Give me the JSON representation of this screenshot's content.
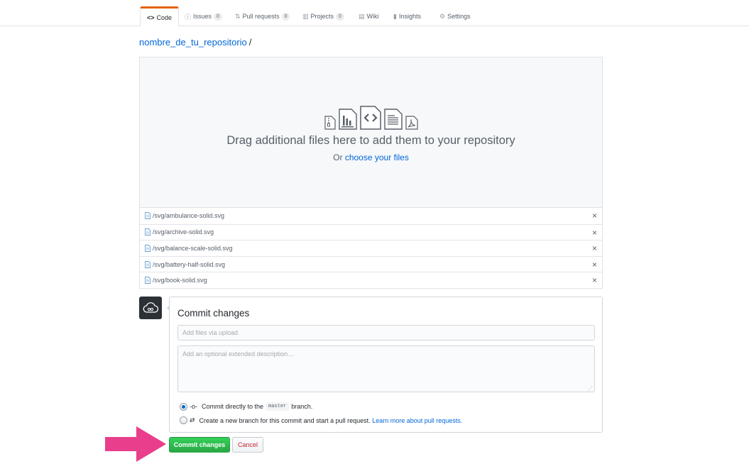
{
  "tabs": [
    {
      "icon": "code-icon",
      "glyph": "<>",
      "label": "Code",
      "selected": true
    },
    {
      "icon": "issue-icon",
      "glyph": "ⓘ",
      "label": "Issues",
      "count": "0"
    },
    {
      "icon": "pull-request-icon",
      "glyph": "⇅",
      "label": "Pull requests",
      "count": "0"
    },
    {
      "icon": "project-icon",
      "glyph": "▥",
      "label": "Projects",
      "count": "0"
    },
    {
      "icon": "wiki-icon",
      "glyph": "▤",
      "label": "Wiki"
    },
    {
      "icon": "graph-icon",
      "glyph": "▮",
      "label": "Insights"
    },
    {
      "icon": "gear-icon",
      "glyph": "⚙",
      "label": "Settings"
    }
  ],
  "breadcrumb": {
    "repo": "nombre_de_tu_repositorio",
    "separator": "/"
  },
  "dropzone": {
    "title": "Drag additional files here to add them to your repository",
    "or_text": "Or ",
    "choose_link": "choose your files"
  },
  "files": [
    {
      "path": "/svg/ambulance-solid.svg",
      "remove": "×"
    },
    {
      "path": "/svg/archive-solid.svg",
      "remove": "×"
    },
    {
      "path": "/svg/balance-scale-solid.svg",
      "remove": "×"
    },
    {
      "path": "/svg/battery-half-solid.svg",
      "remove": "×"
    },
    {
      "path": "/svg/book-solid.svg",
      "remove": "×"
    }
  ],
  "commit": {
    "title": "Commit changes",
    "summary_placeholder": "Add files via upload",
    "description_placeholder": "Add an optional extended description…",
    "resize_glyph": "⋰",
    "option_direct": {
      "icon_glyph": "-o-",
      "prefix": "Commit directly to the",
      "branch": "master",
      "suffix": "branch.",
      "checked": true
    },
    "option_new": {
      "icon_glyph": "⇄",
      "bold": "Create a new branch",
      "text": " for this commit and start a pull request. ",
      "link": "Learn more about pull requests."
    },
    "commit_button": "Commit changes",
    "cancel_button": "Cancel"
  },
  "colors": {
    "accent_tab": "#e36209",
    "link": "#0366d6",
    "commit_green": "#28a745",
    "cancel_red": "#cb2431",
    "arrow_pink": "#e83e8c"
  }
}
